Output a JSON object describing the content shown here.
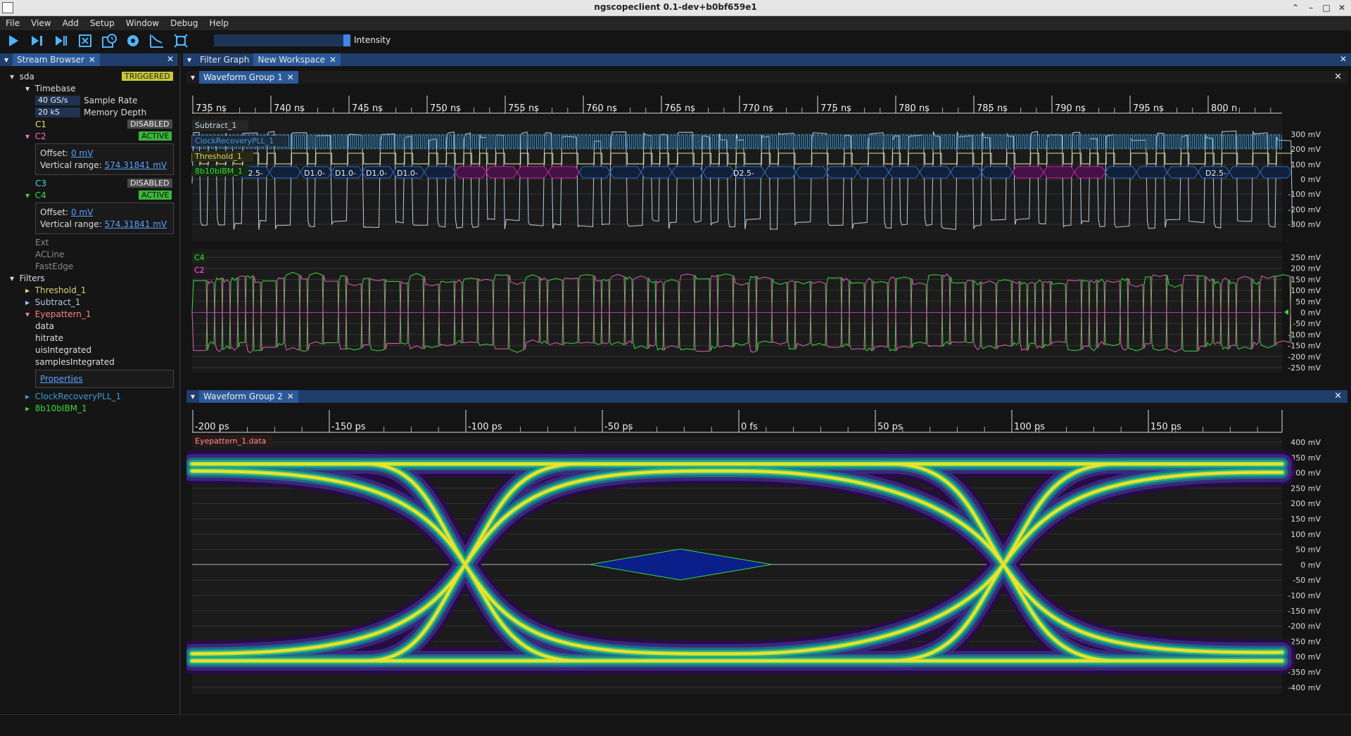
{
  "window": {
    "title": "ngscopeclient 0.1-dev+b0bf659e1"
  },
  "menu": [
    "File",
    "View",
    "Add",
    "Setup",
    "Window",
    "Debug",
    "Help"
  ],
  "toolbar": {
    "intensity_label": "Intensity"
  },
  "stream_browser": {
    "tab_label": "Stream Browser",
    "instrument": "sda",
    "instrument_status": "TRIGGERED",
    "timebase_label": "Timebase",
    "sample_rate_value": "40 GS/s",
    "sample_rate_label": "Sample Rate",
    "memory_depth_value": "20 kS",
    "memory_depth_label": "Memory Depth",
    "channels": [
      {
        "name": "C1",
        "status": "DISABLED",
        "color": "#e6e650"
      },
      {
        "name": "C2",
        "status": "ACTIVE",
        "color": "#ff6ec7",
        "offset_label": "Offset:",
        "offset": "0 mV",
        "range_label": "Vertical range:",
        "range": "574.31841 mV"
      },
      {
        "name": "C3",
        "status": "DISABLED",
        "color": "#4ad8e0"
      },
      {
        "name": "C4",
        "status": "ACTIVE",
        "color": "#3cd83c",
        "offset_label": "Offset:",
        "offset": "0 mV",
        "range_label": "Vertical range:",
        "range": "574.31841 mV"
      }
    ],
    "other_inputs": [
      "Ext",
      "ACLine",
      "FastEdge"
    ],
    "filters_label": "Filters",
    "filters": [
      {
        "name": "Threshold_1",
        "color": "#d4d47a"
      },
      {
        "name": "Subtract_1",
        "color": "#a8c8e8"
      },
      {
        "name": "Eyepattern_1",
        "color": "#ff8080",
        "streams": [
          "data",
          "hitrate",
          "uisIntegrated",
          "samplesIntegrated"
        ],
        "properties_label": "Properties"
      },
      {
        "name": "ClockRecoveryPLL_1",
        "color": "#3a9ad6"
      },
      {
        "name": "8b10bIBM_1",
        "color": "#3cd83c"
      }
    ]
  },
  "main_tabs": [
    "Filter Graph",
    "New Workspace"
  ],
  "waveform_group_1": {
    "title": "Waveform Group 1",
    "time_ticks": [
      "735 ns",
      "740 ns",
      "745 ns",
      "750 ns",
      "755 ns",
      "760 ns",
      "765 ns",
      "770 ns",
      "775 ns",
      "780 ns",
      "785 ns",
      "790 ns",
      "795 ns",
      "800 n"
    ],
    "traces_top": [
      "Subtract_1",
      "ClockRecoveryPLL_1",
      "Threshold_1",
      "8b10bIBM_1"
    ],
    "symbols": [
      "D2.5-",
      "D1.0-",
      "D1.0-",
      "D1.0-",
      "D1.0-",
      "D2.5-",
      "D2.5-"
    ],
    "y_ticks_top": [
      "300 mV",
      "200 mV",
      "100 mV",
      "0 mV",
      "-100 mV",
      "-200 mV",
      "-300 mV"
    ],
    "traces_bottom": [
      "C4",
      "C2"
    ],
    "y_ticks_bottom": [
      "250 mV",
      "200 mV",
      "150 mV",
      "100 mV",
      "50 mV",
      "0 mV",
      "-50 mV",
      "-100 mV",
      "-150 mV",
      "-200 mV",
      "-250 mV"
    ]
  },
  "waveform_group_2": {
    "title": "Waveform Group 2",
    "time_ticks": [
      "-200 ps",
      "-150 ps",
      "-100 ps",
      "-50 ps",
      "0 fs",
      "50 ps",
      "100 ps",
      "150 ps"
    ],
    "trace": "Eyepattern_1.data",
    "y_ticks": [
      "400 mV",
      "350 mV",
      "300 mV",
      "250 mV",
      "200 mV",
      "150 mV",
      "100 mV",
      "50 mV",
      "0 mV",
      "-50 mV",
      "-100 mV",
      "-150 mV",
      "-200 mV",
      "-250 mV",
      "-300 mV",
      "-350 mV",
      "-400 mV"
    ]
  }
}
